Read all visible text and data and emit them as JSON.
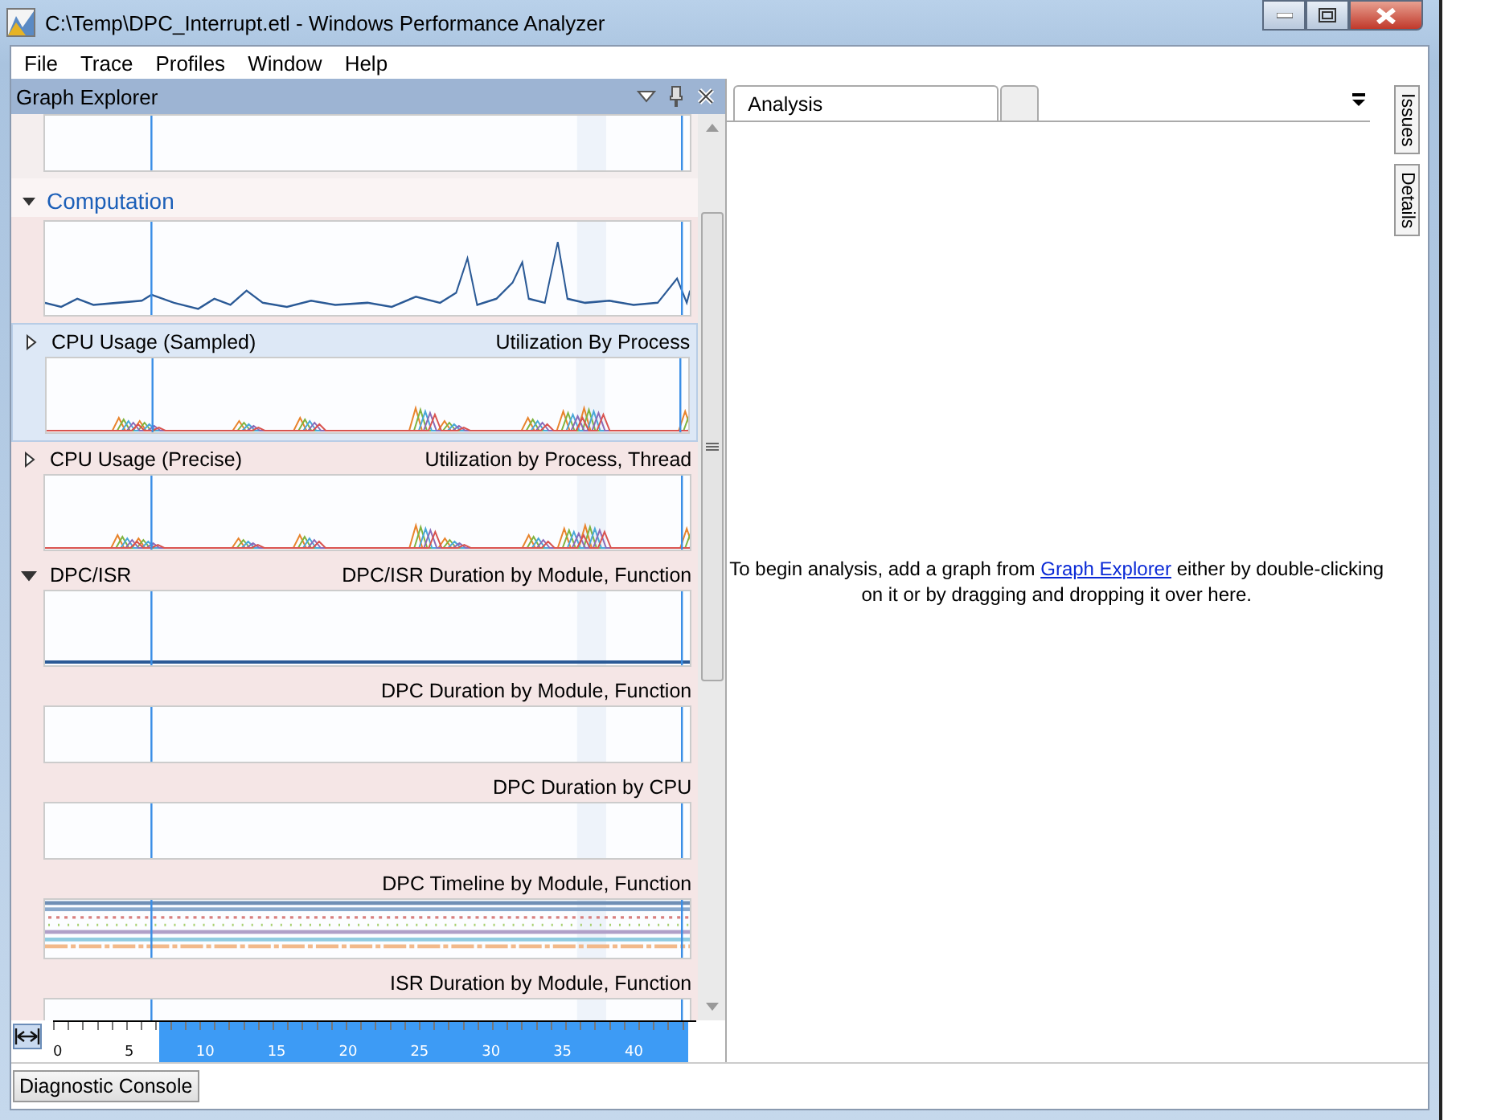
{
  "window": {
    "title": "C:\\Temp\\DPC_Interrupt.etl - Windows Performance Analyzer"
  },
  "menu": [
    "File",
    "Trace",
    "Profiles",
    "Window",
    "Help"
  ],
  "graph_explorer": {
    "title": "Graph Explorer",
    "entries": [
      {
        "kind": "stub",
        "preview": {
          "kind": "empty"
        }
      },
      {
        "kind": "group",
        "title": "Computation",
        "expanded": true
      },
      {
        "kind": "graph",
        "preview": {
          "kind": "line"
        },
        "selected": false
      },
      {
        "kind": "graph",
        "title": "CPU Usage (Sampled)",
        "expanded": false,
        "subtitle": "Utilization By Process",
        "preview": {
          "kind": "multi"
        },
        "selected": true
      },
      {
        "kind": "graph",
        "title": "CPU Usage (Precise)",
        "expanded": false,
        "subtitle": "Utilization by Process, Thread",
        "preview": {
          "kind": "multi"
        },
        "selected": false
      },
      {
        "kind": "graph",
        "title": "DPC/ISR",
        "expanded": true,
        "subtitle": "DPC/ISR Duration by Module, Function",
        "preview": {
          "kind": "flat"
        },
        "selected": false
      },
      {
        "kind": "graph",
        "subtitle": "DPC Duration by Module, Function",
        "preview": {
          "kind": "empty"
        },
        "selected": false
      },
      {
        "kind": "graph",
        "subtitle": "DPC Duration by CPU",
        "preview": {
          "kind": "empty"
        },
        "selected": false
      },
      {
        "kind": "graph",
        "subtitle": "DPC Timeline by Module, Function",
        "preview": {
          "kind": "timeline"
        },
        "selected": false
      },
      {
        "kind": "graph",
        "subtitle": "ISR Duration by Module, Function",
        "preview": {
          "kind": "partial"
        },
        "selected": false
      }
    ],
    "axis_ticks": [
      "0",
      "5",
      "10",
      "15",
      "20",
      "25",
      "30",
      "35",
      "40"
    ]
  },
  "tabs": [
    {
      "label": "Analysis",
      "selected": true
    }
  ],
  "side_tabs": [
    "Issues",
    "Details"
  ],
  "hint": {
    "before": "To begin analysis, add a graph from ",
    "link": "Graph Explorer",
    "after": " either by double-clicking on it or by dragging and dropping it over here."
  },
  "bottom_button": "Diagnostic Console"
}
